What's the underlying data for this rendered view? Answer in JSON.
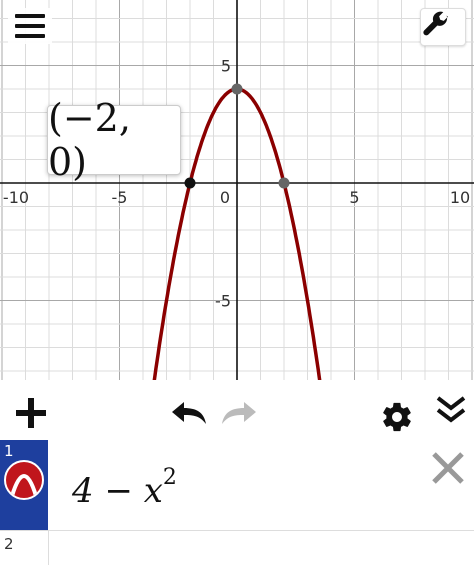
{
  "graph": {
    "x_ticks": [
      "-10",
      "-5",
      "0",
      "5",
      "10"
    ],
    "y_ticks": [
      "5",
      "-5"
    ],
    "xlim": [
      -10,
      10
    ],
    "ylim": [
      -8,
      5.6
    ],
    "curve_color": "#8b0000",
    "point_label": "(−2, 0)"
  },
  "toolbar": {
    "add_label": "add",
    "undo_label": "undo",
    "redo_label": "redo",
    "settings_label": "settings",
    "collapse_label": "collapse"
  },
  "expressions": [
    {
      "index": "1",
      "base": "4 − x",
      "exp": "2",
      "color": "#c0161c"
    },
    {
      "index": "2",
      "base": "",
      "exp": ""
    }
  ]
}
